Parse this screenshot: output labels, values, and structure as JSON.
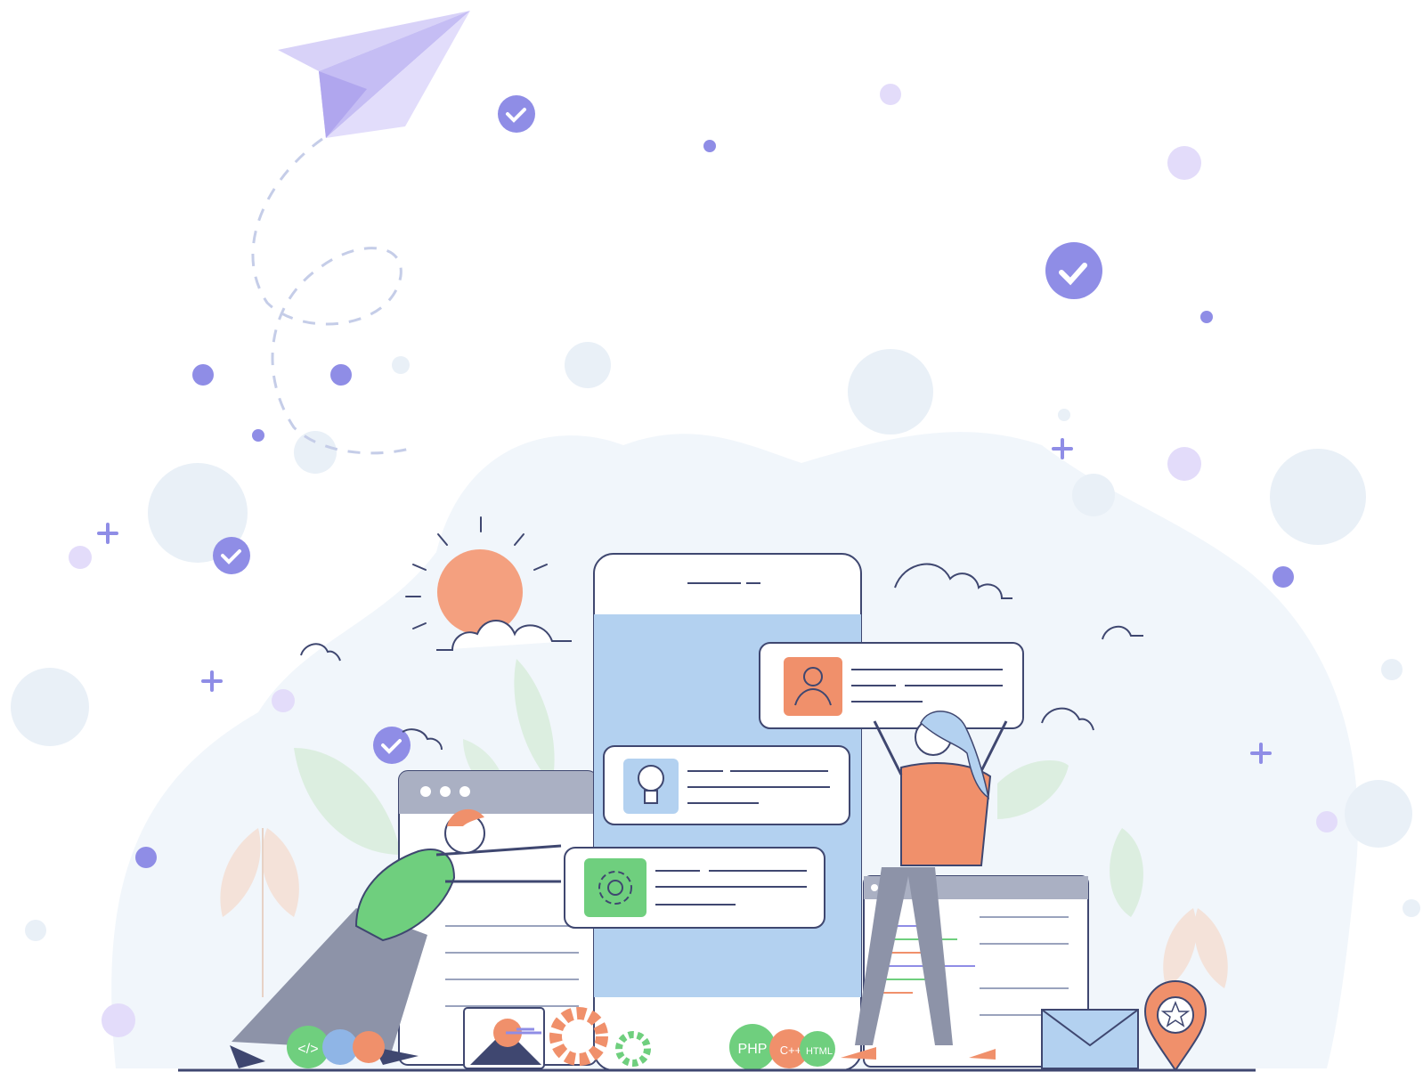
{
  "illustration": {
    "colors": {
      "background": "#ffffff",
      "blob": "#f1f6fb",
      "bubble": "#e8eff7",
      "accent_purple": "#8f8de6",
      "light_purple": "#e3dcfa",
      "phone_screen": "#b3d1f0",
      "orange": "#f0906b",
      "green": "#6fcf7e",
      "outline": "#3f4770"
    },
    "badges": {
      "php": "PHP",
      "cpp": "C++",
      "html": "HTML",
      "code": "</>"
    },
    "icons": [
      "paper-plane-icon",
      "check-icon",
      "sun-icon",
      "cloud-icon",
      "user-icon",
      "lightbulb-icon",
      "gear-icon",
      "image-icon",
      "envelope-icon",
      "location-pin-icon",
      "star-icon",
      "plus-icon"
    ]
  }
}
